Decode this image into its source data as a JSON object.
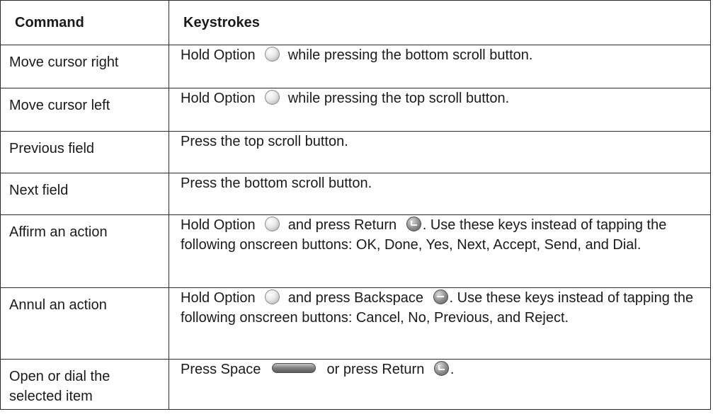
{
  "table": {
    "headers": {
      "command": "Command",
      "keystrokes": "Keystrokes"
    },
    "rows": [
      {
        "command": "Move cursor right",
        "keys": {
          "before": "Hold Option",
          "icon1": "option-key-icon",
          "after": "while pressing the bottom scroll button."
        }
      },
      {
        "command": "Move cursor left",
        "keys": {
          "before": "Hold Option",
          "icon1": "option-key-icon",
          "after": "while pressing the top scroll button."
        }
      },
      {
        "command": "Previous field",
        "keys": {
          "text": "Press the top scroll button."
        }
      },
      {
        "command": "Next field",
        "keys": {
          "text": "Press the bottom scroll button."
        }
      },
      {
        "command": "Affirm an action",
        "keys": {
          "before": "Hold Option",
          "icon1": "option-key-icon",
          "middle": "and press Return",
          "icon2": "return-key-icon",
          "after": ". Use these keys instead of tapping the following onscreen buttons: OK, Done, Yes, Next, Accept, Send, and Dial."
        }
      },
      {
        "command": "Annul an action",
        "keys": {
          "before": "Hold Option",
          "icon1": "option-key-icon",
          "middle": "and press Backspace",
          "icon2": "backspace-key-icon",
          "after": ". Use these keys instead of tapping the following onscreen buttons: Cancel, No, Previous, and Reject."
        }
      },
      {
        "command": "Open or dial the selected item",
        "keys": {
          "before": "Press Space",
          "icon1": "space-key-icon",
          "middle": "or press Return",
          "icon2": "return-key-icon",
          "after": "."
        }
      }
    ]
  }
}
